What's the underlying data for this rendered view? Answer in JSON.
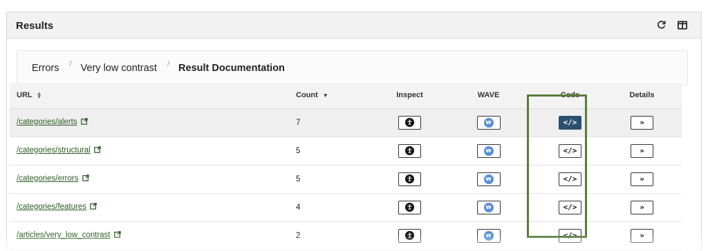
{
  "panel": {
    "title": "Results",
    "icons": [
      "refresh-icon",
      "columns-icon"
    ]
  },
  "breadcrumb": {
    "items": [
      "Errors",
      "Very low contrast",
      "Result Documentation"
    ],
    "separator": "/"
  },
  "table": {
    "headers": {
      "url": "URL",
      "count": "Count",
      "inspect": "Inspect",
      "wave": "WAVE",
      "code": "Code",
      "details": "Details"
    },
    "rows": [
      {
        "url": "/categories/alerts",
        "count": "7",
        "code_active": true
      },
      {
        "url": "/categories/structural",
        "count": "5",
        "code_active": false
      },
      {
        "url": "/categories/errors",
        "count": "5",
        "code_active": false
      },
      {
        "url": "/categories/features",
        "count": "4",
        "code_active": false
      },
      {
        "url": "/articles/very_low_contrast",
        "count": "2",
        "code_active": false
      }
    ],
    "button_glyphs": {
      "code": "</>",
      "details": "»",
      "wave": "w"
    }
  },
  "colors": {
    "link": "#2d5b25",
    "code_active": "#2b4f6e",
    "highlight_box": "#5a7a3a",
    "wave_icon": "#5b8fd6"
  }
}
